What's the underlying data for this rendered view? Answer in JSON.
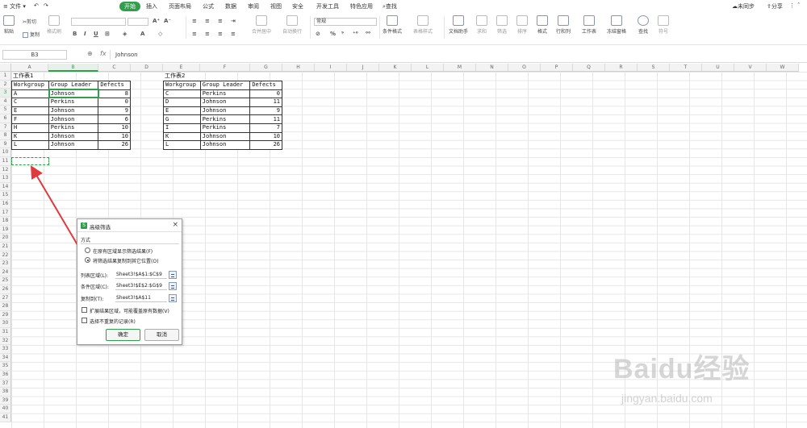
{
  "menubar": {
    "file": "文件",
    "items": [
      "开始",
      "插入",
      "页面布局",
      "公式",
      "数据",
      "审阅",
      "视图",
      "安全",
      "开发工具",
      "特色应用",
      "查找"
    ],
    "active_index": 0,
    "sync": "未同步",
    "share": "分享"
  },
  "ribbon": {
    "cut": "剪切",
    "copy": "复制",
    "paste": "粘贴",
    "format_painter": "格式刷",
    "number_format": "常规",
    "merge_center": "合并居中",
    "wrap_text": "自动换行",
    "conditional_format": "条件格式",
    "table_style": "表格样式",
    "doc_helper": "文档助手",
    "sum": "求和",
    "filter": "筛选",
    "sort": "排序",
    "format": "格式",
    "rows_cols": "行和列",
    "worksheet": "工作表",
    "freeze": "冻结窗格",
    "find": "查找",
    "symbol": "符号"
  },
  "formula_bar": {
    "name_box": "B3",
    "fx": "fx",
    "value": "Johnson"
  },
  "columns": [
    "A",
    "B",
    "C",
    "D",
    "E",
    "F",
    "G",
    "H",
    "I",
    "J",
    "K",
    "L",
    "M",
    "N",
    "O",
    "P",
    "Q",
    "R",
    "S",
    "T",
    "U",
    "V",
    "W"
  ],
  "rows": [
    "1",
    "2",
    "3",
    "4",
    "5",
    "6",
    "7",
    "8",
    "9",
    "10",
    "11",
    "12",
    "13",
    "14",
    "15",
    "16",
    "17",
    "18",
    "19",
    "20",
    "21",
    "22",
    "23",
    "24",
    "25",
    "26",
    "27",
    "28",
    "29",
    "30",
    "31",
    "32",
    "33",
    "34",
    "35",
    "36",
    "37",
    "38",
    "39",
    "40",
    "41"
  ],
  "sheet1": {
    "title": "工作表1",
    "headers": [
      "Workgroup",
      "Group Leader",
      "Defects"
    ],
    "rows": [
      [
        "A",
        "Johnson",
        "8"
      ],
      [
        "C",
        "Perkins",
        "0"
      ],
      [
        "E",
        "Johnson",
        "9"
      ],
      [
        "F",
        "Johnson",
        "6"
      ],
      [
        "H",
        "Perkins",
        "10"
      ],
      [
        "K",
        "Johnson",
        "10"
      ],
      [
        "L",
        "Johnson",
        "26"
      ]
    ]
  },
  "sheet2": {
    "title": "工作表2",
    "headers": [
      "Workgroup",
      "Group Leader",
      "Defects"
    ],
    "rows": [
      [
        "C",
        "Perkins",
        "0"
      ],
      [
        "D",
        "Johnson",
        "11"
      ],
      [
        "E",
        "Johnson",
        "9"
      ],
      [
        "G",
        "Perkins",
        "11"
      ],
      [
        "I",
        "Perkins",
        "7"
      ],
      [
        "K",
        "Johnson",
        "10"
      ],
      [
        "L",
        "Johnson",
        "26"
      ]
    ]
  },
  "dialog": {
    "title": "高级筛选",
    "close": "×",
    "method_label": "方式",
    "option_in_place": "在原有区域显示筛选结果(F)",
    "option_copy": "将筛选结果复制到其它位置(O)",
    "list_range_label": "列表区域(L):",
    "list_range_value": "Sheet3!$A$1:$C$9",
    "criteria_label": "条件区域(C):",
    "criteria_value": "Sheet3!$E$2:$G$9",
    "copy_to_label": "复制到(T):",
    "copy_to_value": "Sheet3!$A$11",
    "expand_label": "扩展结果区域，可能覆盖原有数据(V)",
    "unique_label": "选择不重复的记录(R)",
    "ok": "确定",
    "cancel": "取消"
  },
  "watermark": {
    "text": "Baidu经验",
    "url": "jingyan.baidu.com"
  },
  "colors": {
    "accent": "#2f9f4b",
    "arrow": "#e0393e"
  }
}
